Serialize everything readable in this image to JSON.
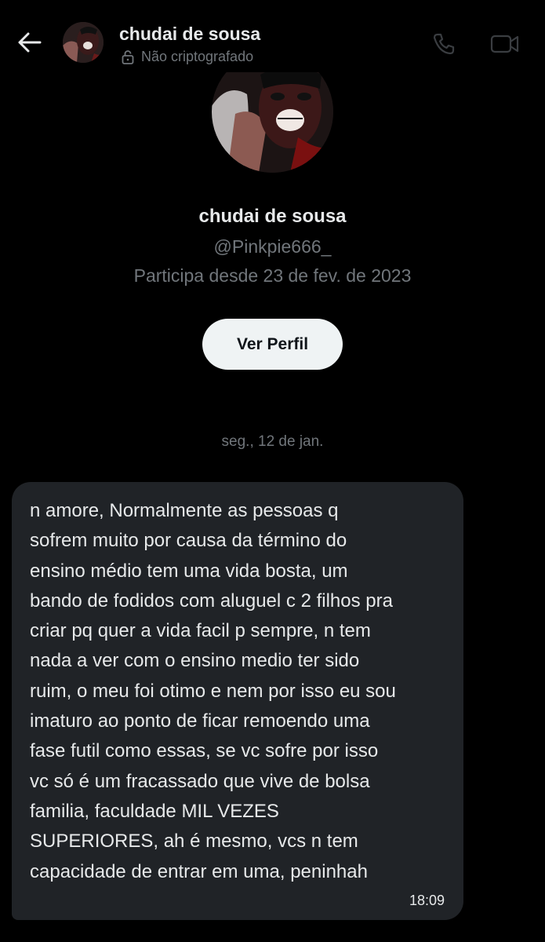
{
  "header": {
    "name": "chudai de sousa",
    "encryption_status": "Não criptografado"
  },
  "profile": {
    "name": "chudai de sousa",
    "handle": "@Pinkpie666_",
    "joined": "Participa desde 23 de fev. de 2023",
    "view_profile_label": "Ver Perfil"
  },
  "conversation": {
    "date_separator": "seg., 12 de jan.",
    "messages": [
      {
        "text": "n amore, Normalmente as pessoas q\nsofrem muito por causa da término do\nensino médio tem uma vida bosta, um\nbando de fodidos com aluguel c 2 filhos pra\ncriar pq quer a vida facil p sempre, n tem\nnada a ver com o ensino medio ter sido\nruim, o meu foi otimo e nem por isso eu sou\nimaturo ao ponto de ficar remoendo uma\nfase futil como essas, se vc sofre por isso\nvc só é um fracassado que vive de bolsa\nfamilia, faculdade MIL VEZES\nSUPERIORES, ah é mesmo, vcs n tem\ncapacidade de entrar em uma, peninhah",
        "time": "18:09"
      }
    ]
  },
  "icons": {
    "back": "arrow-left-icon",
    "lock": "lock-icon",
    "call": "phone-icon",
    "video": "video-camera-icon"
  },
  "colors": {
    "background": "#000000",
    "primary_text": "#e7e9ea",
    "secondary_text": "#71767b",
    "bubble": "#202327",
    "button_bg": "#eff3f4"
  }
}
